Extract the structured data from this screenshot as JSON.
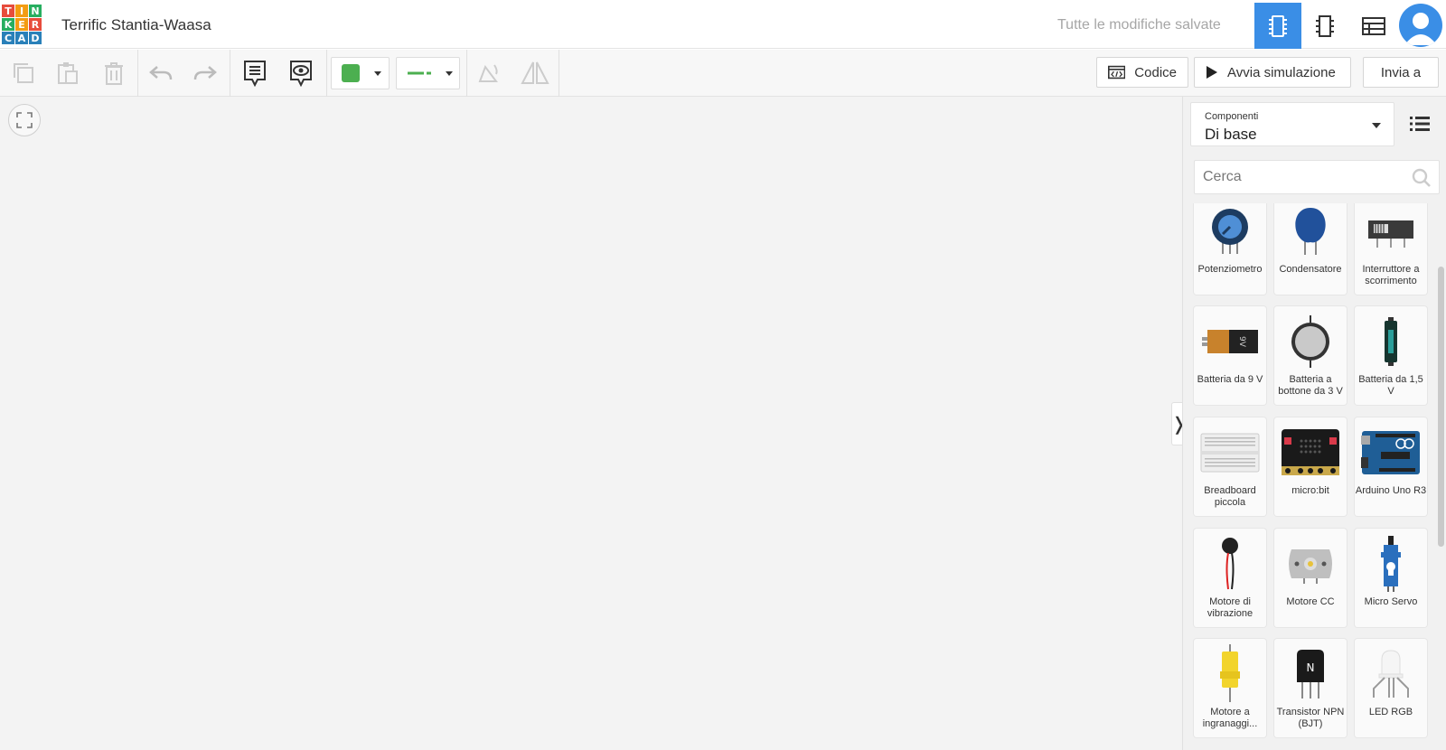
{
  "header": {
    "logo_letters": [
      "T",
      "I",
      "N",
      "K",
      "E",
      "R",
      "C",
      "A",
      "D"
    ],
    "project_title": "Terrific Stantia-Waasa",
    "save_status": "Tutte le modifiche salvate",
    "views": [
      "circuit-view-icon",
      "schematic-view-icon",
      "component-list-icon"
    ],
    "active_view": "circuit-view-icon",
    "avatar": "user-avatar-icon"
  },
  "toolbar": {
    "code_label": "Codice",
    "simulate_label": "Avvia simulazione",
    "send_label": "Invia a",
    "wire_color": "#4caf50"
  },
  "panel": {
    "components_label": "Componenti",
    "components_value": "Di base",
    "search_placeholder": "Cerca",
    "items": [
      {
        "name": "Potenziometro",
        "icon": "potentiometer-icon"
      },
      {
        "name": "Condensatore",
        "icon": "capacitor-icon"
      },
      {
        "name": "Interruttore a scorrimento",
        "icon": "slide-switch-icon"
      },
      {
        "name": "Batteria da 9 V",
        "icon": "battery-9v-icon"
      },
      {
        "name": "Batteria a bottone da 3 V",
        "icon": "coin-battery-icon"
      },
      {
        "name": "Batteria da 1,5 V",
        "icon": "battery-aa-icon"
      },
      {
        "name": "Breadboard piccola",
        "icon": "breadboard-icon"
      },
      {
        "name": "micro:bit",
        "icon": "microbit-icon"
      },
      {
        "name": "Arduino Uno R3",
        "icon": "arduino-icon"
      },
      {
        "name": "Motore di vibrazione",
        "icon": "vibration-motor-icon"
      },
      {
        "name": "Motore CC",
        "icon": "dc-motor-icon"
      },
      {
        "name": "Micro Servo",
        "icon": "micro-servo-icon"
      },
      {
        "name": "Motore a ingranaggi...",
        "icon": "gear-motor-icon"
      },
      {
        "name": "Transistor NPN (BJT)",
        "icon": "npn-transistor-icon"
      },
      {
        "name": "LED RGB",
        "icon": "rgb-led-icon"
      }
    ]
  },
  "colors": {
    "accent": "#3a8ee6",
    "logo": [
      "#e74c3c",
      "#f39c12",
      "#27ae60",
      "#27ae60",
      "#f39c12",
      "#e74c3c",
      "#2980b9",
      "#2980b9",
      "#2980b9"
    ]
  }
}
